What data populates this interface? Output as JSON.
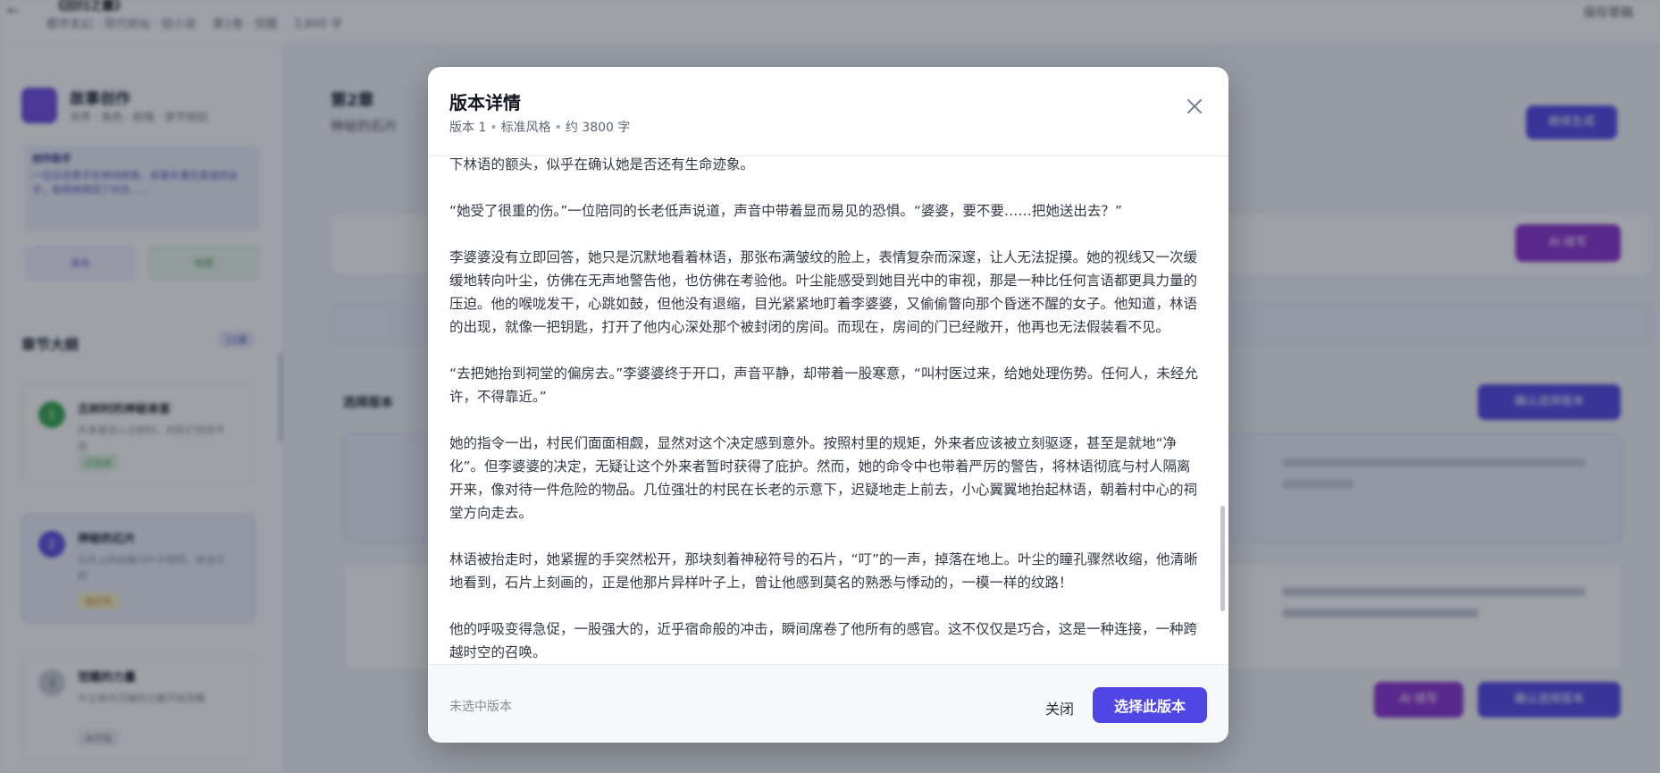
{
  "background": {
    "header": {
      "back_icon": "arrow-left-icon",
      "title": "《回归之靈》",
      "breadcrumbs": [
        "都市玄幻 · 现代修仙 · 轻小说",
        "第1卷 · 觉醒",
        "3,800 字"
      ],
      "right_label": "保存草稿"
    },
    "sidebar": {
      "app_title": "故事创作",
      "app_subtitle": "世界 · 角色 · 剧情 · 章节规划",
      "info_title": "创作助手",
      "info_text": "一位白衣男子在林间修炼，却意外遇见昏迷的女子。他将她带回了村庄……",
      "btn_a": "角色",
      "btn_b": "地图",
      "chapters_label": "章节大纲",
      "chapters_badge": "12章",
      "chapters": [
        {
          "num": "1",
          "title": "古树村的神秘来客",
          "desc": "外来者闯入古树村，村民们惊恐不安",
          "tag": "已完成"
        },
        {
          "num": "2",
          "title": "神秘的石片",
          "desc": "石片上的纹路与叶子相同，命运交织",
          "tag": "进行中"
        },
        {
          "num": "3",
          "title": "觉醒的力量",
          "desc": "叶尘体内沉睡的力量开始苏醒",
          "tag": "未开始"
        }
      ]
    },
    "main": {
      "chapter_label": "第2章",
      "chapter_title": "神秘的石片",
      "primary_action": "继续生成",
      "ai_action": "AI 续写",
      "versions_label": "选择版本",
      "compare_action": "确认选择版本"
    }
  },
  "modal": {
    "title": "版本详情",
    "meta": [
      "版本 1",
      "标准风格",
      "约 3800 字"
    ],
    "paragraphs": [
      "下林语的额头，似乎在确认她是否还有生命迹象。",
      "“她受了很重的伤。”一位陪同的长老低声说道，声音中带着显而易见的恐惧。“婆婆，要不要……把她送出去？”",
      "李婆婆没有立即回答，她只是沉默地看着林语，那张布满皱纹的脸上，表情复杂而深邃，让人无法捉摸。她的视线又一次缓缓地转向叶尘，仿佛在无声地警告他，也仿佛在考验他。叶尘能感受到她目光中的审视，那是一种比任何言语都更具力量的压迫。他的喉咙发干，心跳如鼓，但他没有退缩，目光紧紧地盯着李婆婆，又偷偷瞥向那个昏迷不醒的女子。他知道，林语的出现，就像一把钥匙，打开了他内心深处那个被封闭的房间。而现在，房间的门已经敞开，他再也无法假装看不见。",
      "“去把她抬到祠堂的偏房去。”李婆婆终于开口，声音平静，却带着一股寒意，“叫村医过来，给她处理伤势。任何人，未经允许，不得靠近。”",
      "她的指令一出，村民们面面相觑，显然对这个决定感到意外。按照村里的规矩，外来者应该被立刻驱逐，甚至是就地“净化”。但李婆婆的决定，无疑让这个外来者暂时获得了庇护。然而，她的命令中也带着严厉的警告，将林语彻底与村人隔离开来，像对待一件危险的物品。几位强壮的村民在长老的示意下，迟疑地走上前去，小心翼翼地抬起林语，朝着村中心的祠堂方向走去。",
      "林语被抬走时，她紧握的手突然松开，那块刻着神秘符号的石片，“叮”的一声，掉落在地上。叶尘的瞳孔骤然收缩，他清晰地看到，石片上刻画的，正是他那片异样叶子上，曾让他感到莫名的熟悉与悸动的，一模一样的纹路！",
      "他的呼吸变得急促，一股强大的，近乎宿命般的冲击，瞬间席卷了他所有的感官。这不仅仅是巧合，这是一种连接，一种跨越时空的召唤。"
    ],
    "footer": {
      "status": "未选中版本",
      "close_label": "关闭",
      "select_label": "选择此版本"
    }
  },
  "colors": {
    "accent": "#4f46e5",
    "overlay": "rgba(25,30,45,0.42)",
    "ai_purple": "#8b2fd1"
  }
}
